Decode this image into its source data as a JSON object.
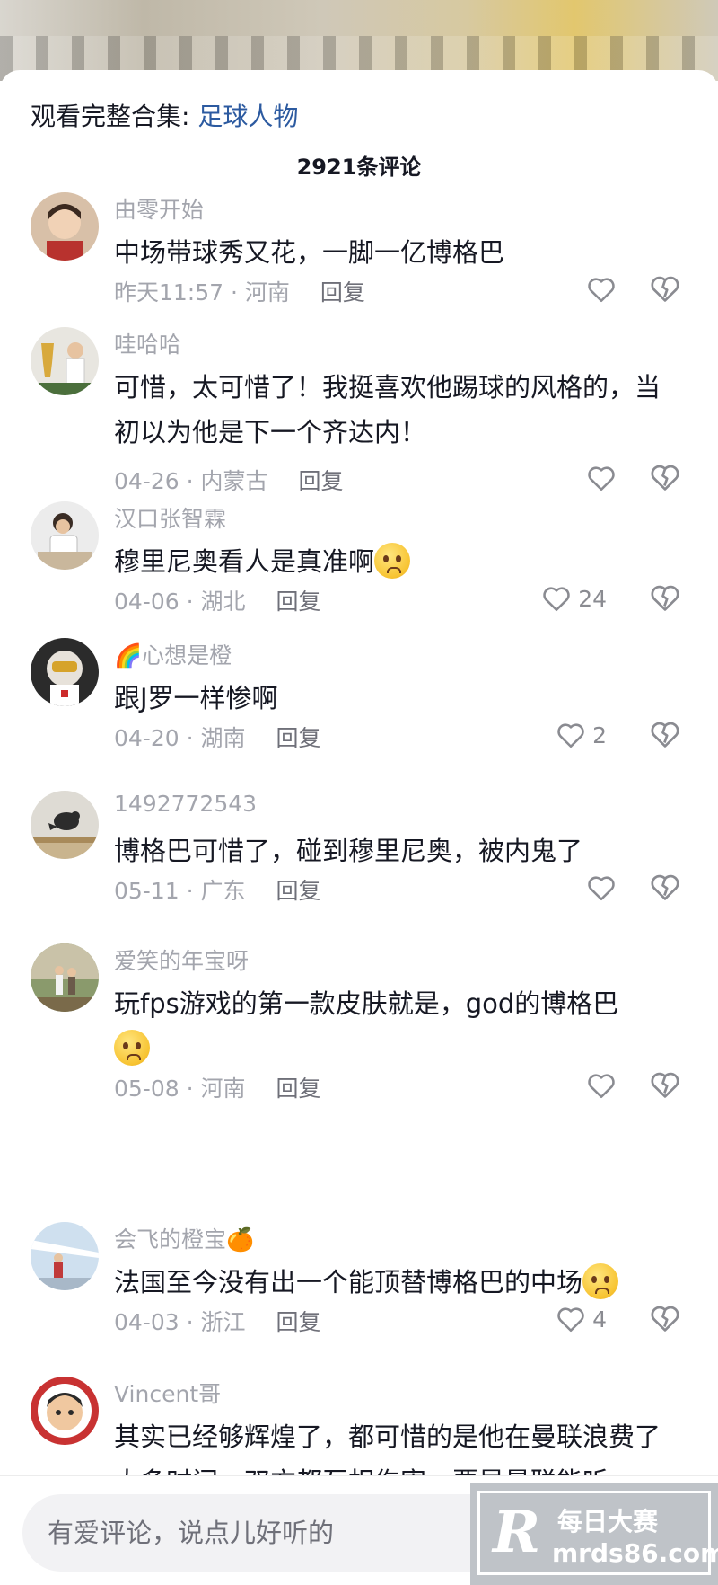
{
  "header": {
    "collection_prefix": "观看完整合集: ",
    "collection_link": "足球人物",
    "comment_count": "2921条评论"
  },
  "comments": [
    {
      "username": "由零开始",
      "text": "中场带球秀又花，一脚一亿博格巴",
      "time": "昨天11:57",
      "location": "河南",
      "reply": "回复",
      "likes": ""
    },
    {
      "username": "哇哈哈",
      "text": "可惜，太可惜了！我挺喜欢他踢球的风格的，当初以为他是下一个齐达内！",
      "time": "04-26",
      "location": "内蒙古",
      "reply": "回复",
      "likes": ""
    },
    {
      "username": "汉口张智霖",
      "text": "穆里尼奥看人是真准啊",
      "time": "04-06",
      "location": "湖北",
      "reply": "回复",
      "likes": "24"
    },
    {
      "username": "🌈心想是橙",
      "text": "跟J罗一样惨啊",
      "time": "04-20",
      "location": "湖南",
      "reply": "回复",
      "likes": "2"
    },
    {
      "username": "1492772543",
      "text": "博格巴可惜了，碰到穆里尼奥，被内鬼了",
      "time": "05-11",
      "location": "广东",
      "reply": "回复",
      "likes": ""
    },
    {
      "username": "爱笑的年宝呀",
      "text": "玩fps游戏的第一款皮肤就是，god的博格巴",
      "time": "05-08",
      "location": "河南",
      "reply": "回复",
      "likes": ""
    },
    {
      "username": "会飞的橙宝🍊",
      "text": "法国至今没有出一个能顶替博格巴的中场",
      "time": "04-03",
      "location": "浙江",
      "reply": "回复",
      "likes": "4"
    },
    {
      "username": "Vincent哥",
      "text": "其实已经够辉煌了，都可惜的是他在曼联浪费了太多时间，双方都互相伤害，要是曼联能听",
      "time": "",
      "location": "",
      "reply": "",
      "likes": ""
    }
  ],
  "meta_separator": " · ",
  "input": {
    "placeholder": "有爱评论，说点儿好听的"
  },
  "watermark": {
    "logo_letter": "R",
    "title": "每日大赛",
    "url": "mrds86.com"
  },
  "colors": {
    "link": "#2c5aa0",
    "secondary_text": "#a3a5ad",
    "primary_text": "#161823"
  },
  "icons": {
    "like": "heart-outline-icon",
    "dislike": "broken-heart-icon",
    "emoji": "pleading-face-emoji"
  }
}
